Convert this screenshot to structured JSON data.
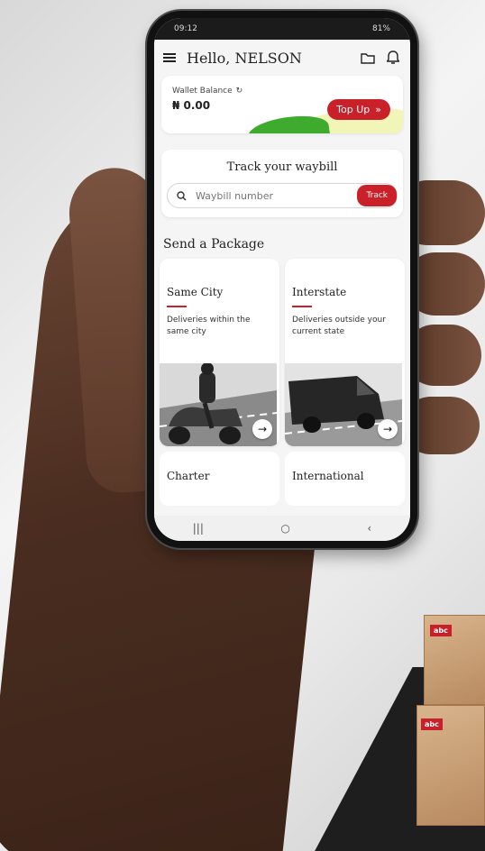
{
  "status": {
    "time": "09:12",
    "battery": "81%"
  },
  "header": {
    "greeting": "Hello, NELSON"
  },
  "wallet": {
    "label": "Wallet Balance",
    "amount": "₦ 0.00",
    "topup_label": "Top Up"
  },
  "track": {
    "title": "Track your waybill",
    "placeholder": "Waybill number",
    "button_label": "Track"
  },
  "send": {
    "title": "Send a Package",
    "tiles": [
      {
        "title": "Same City",
        "desc": "Deliveries within the same city"
      },
      {
        "title": "Interstate",
        "desc": "Deliveries outside your current state"
      }
    ],
    "more": [
      {
        "title": "Charter"
      },
      {
        "title": "International"
      }
    ]
  },
  "boxes": {
    "label": "abc"
  },
  "colors": {
    "accent": "#c9202a",
    "green": "#3eaa2e"
  }
}
